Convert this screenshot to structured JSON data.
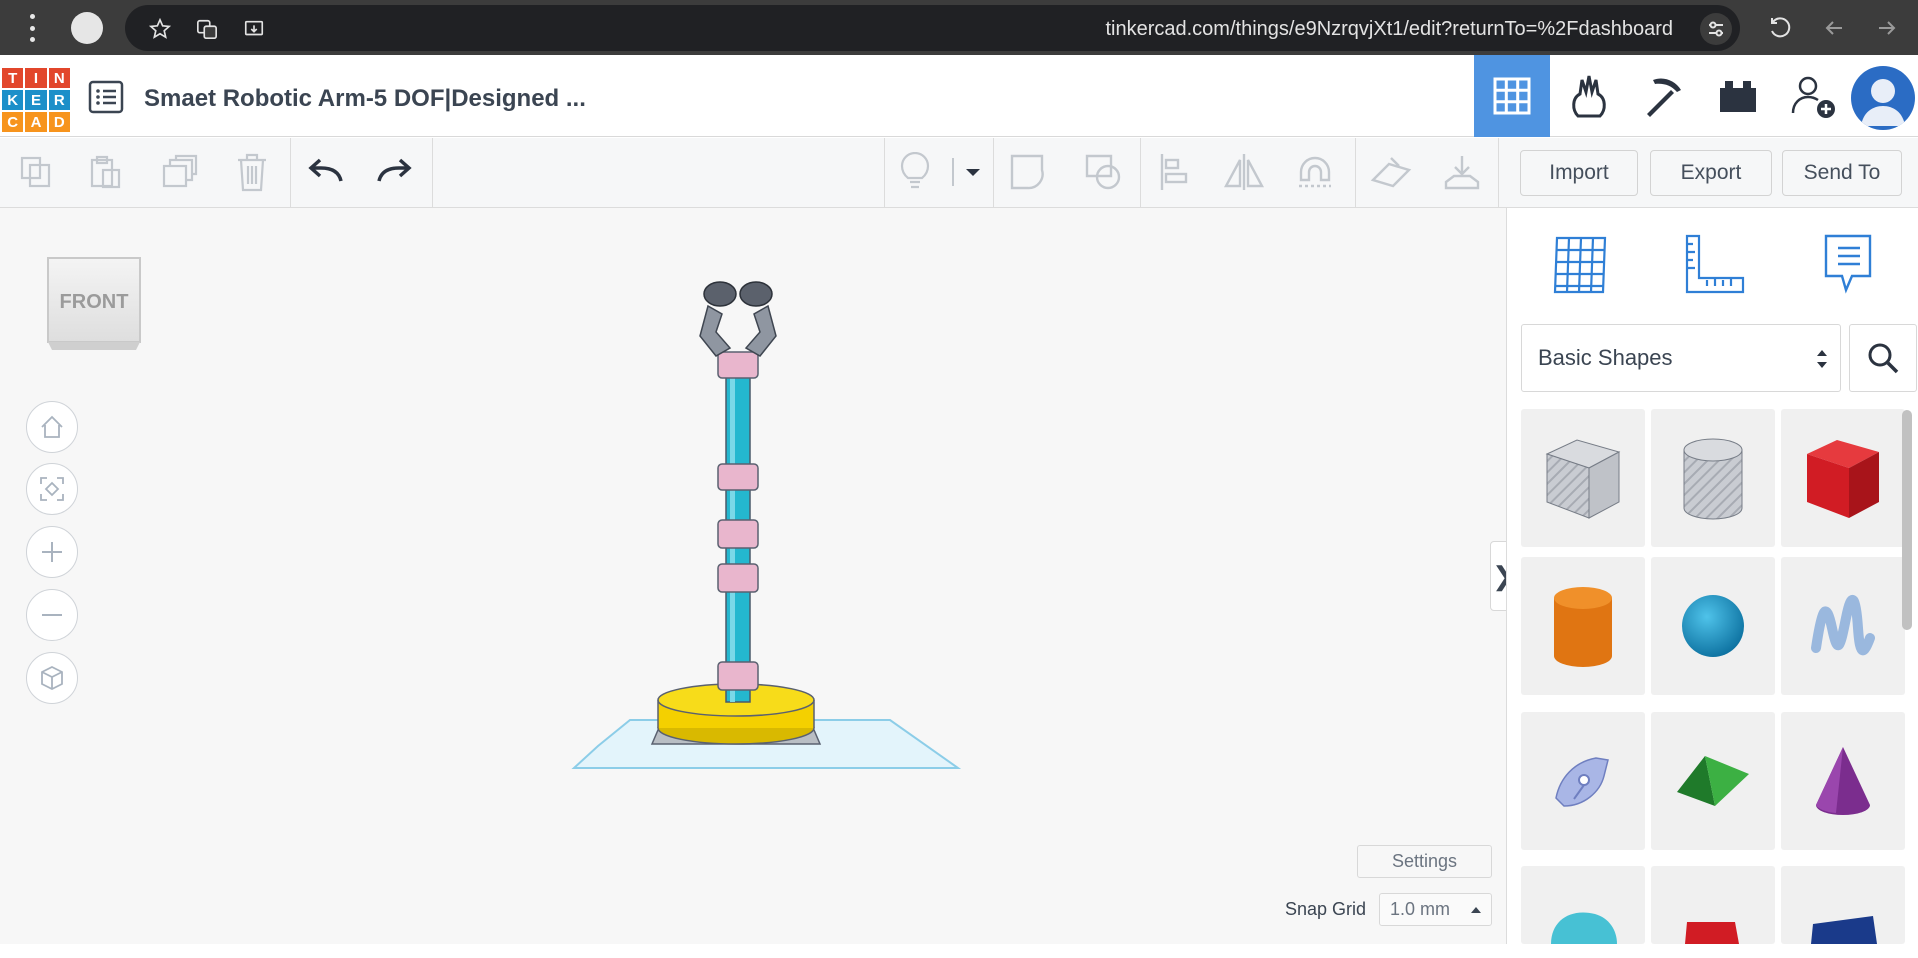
{
  "browser": {
    "url": "tinkercad.com/things/e9NzrqvjXt1/edit?returnTo=%2Fdashboard",
    "icons": [
      "menu-dots-icon",
      "profile-icon",
      "bookmark-star-icon",
      "translate-icon",
      "cast-icon",
      "tune-icon",
      "reload-icon",
      "back-icon",
      "forward-icon"
    ]
  },
  "header": {
    "logo_letters": [
      "T",
      "I",
      "N",
      "K",
      "E",
      "R",
      "C",
      "A",
      "D"
    ],
    "logo_colors": [
      "#e2462b",
      "#e2462b",
      "#e2462b",
      "#1c8fc9",
      "#1c8fc9",
      "#1c8fc9",
      "#f7941d",
      "#f7941d",
      "#f7941d"
    ],
    "title": "Smaet Robotic Arm-5 DOF|Designed ...",
    "nav_icons": [
      "3d-design-icon",
      "circuits-icon",
      "minecraft-pickaxe-icon",
      "bricks-icon",
      "invite-user-icon"
    ],
    "accent": "#4f94e1"
  },
  "toolbar": {
    "import_label": "Import",
    "export_label": "Export",
    "sendto_label": "Send To"
  },
  "workplane": {
    "view_cube_label": "FRONT",
    "settings_label": "Settings",
    "snap_grid_label": "Snap Grid",
    "snap_grid_value": "1.0 mm",
    "collapse_glyph": "❯"
  },
  "panel": {
    "shape_library": "Basic Shapes",
    "shapes": [
      {
        "name": "box-hole",
        "color": "#b8bcc4"
      },
      {
        "name": "cylinder-hole",
        "color": "#c6c8cc"
      },
      {
        "name": "box",
        "color": "#d81f26"
      },
      {
        "name": "cylinder",
        "color": "#e57b16"
      },
      {
        "name": "sphere",
        "color": "#1b96c9"
      },
      {
        "name": "scribble",
        "color": "#a9c4e6"
      },
      {
        "name": "shape-generator",
        "color": "#a4b1e6"
      },
      {
        "name": "roof",
        "color": "#2e9a3a"
      },
      {
        "name": "cone",
        "color": "#7b2d8e"
      },
      {
        "name": "round-roof",
        "color": "#4cc2d4"
      },
      {
        "name": "text",
        "color": "#d81f26"
      },
      {
        "name": "wedge",
        "color": "#1a3a8a"
      }
    ]
  }
}
